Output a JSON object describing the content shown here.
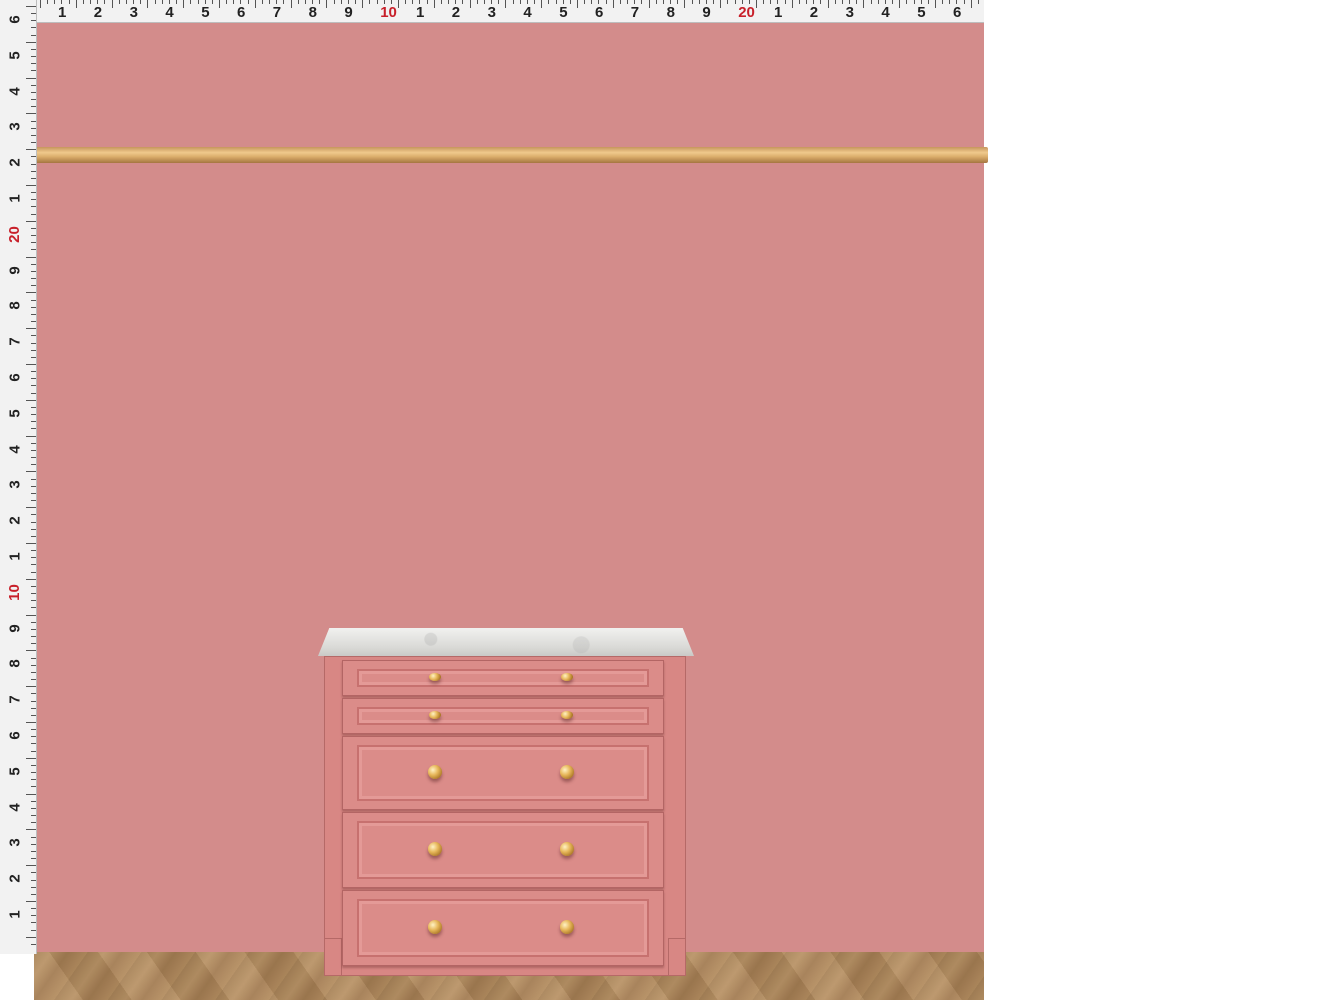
{
  "scene": {
    "colors": {
      "wall": "#d38c8b",
      "rail": "#dcae6c",
      "dresser": "#db8c89",
      "marble_top": "#e3e3e0",
      "floor": "#b08a5c",
      "ruler_text": "#222222",
      "ruler_highlight": "#c8202a"
    },
    "dresser": {
      "drawer_count": 5,
      "knobs_per_drawer": 2,
      "knob_finish": "brass"
    }
  },
  "ruler_top": {
    "labels": [
      "1",
      "2",
      "3",
      "4",
      "5",
      "6",
      "7",
      "8",
      "9",
      "10",
      "1",
      "2",
      "3",
      "4",
      "5",
      "6",
      "7",
      "8",
      "9",
      "20",
      "1",
      "2",
      "3",
      "4",
      "5",
      "6"
    ],
    "highlight": [
      "10",
      "20"
    ]
  },
  "ruler_left": {
    "labels": [
      "6",
      "5",
      "4",
      "3",
      "2",
      "1",
      "20",
      "9",
      "8",
      "7",
      "6",
      "5",
      "4",
      "3",
      "2",
      "1",
      "10",
      "9",
      "8",
      "7",
      "6",
      "5",
      "4",
      "3",
      "2",
      "1"
    ],
    "highlight": [
      "10",
      "20"
    ]
  }
}
